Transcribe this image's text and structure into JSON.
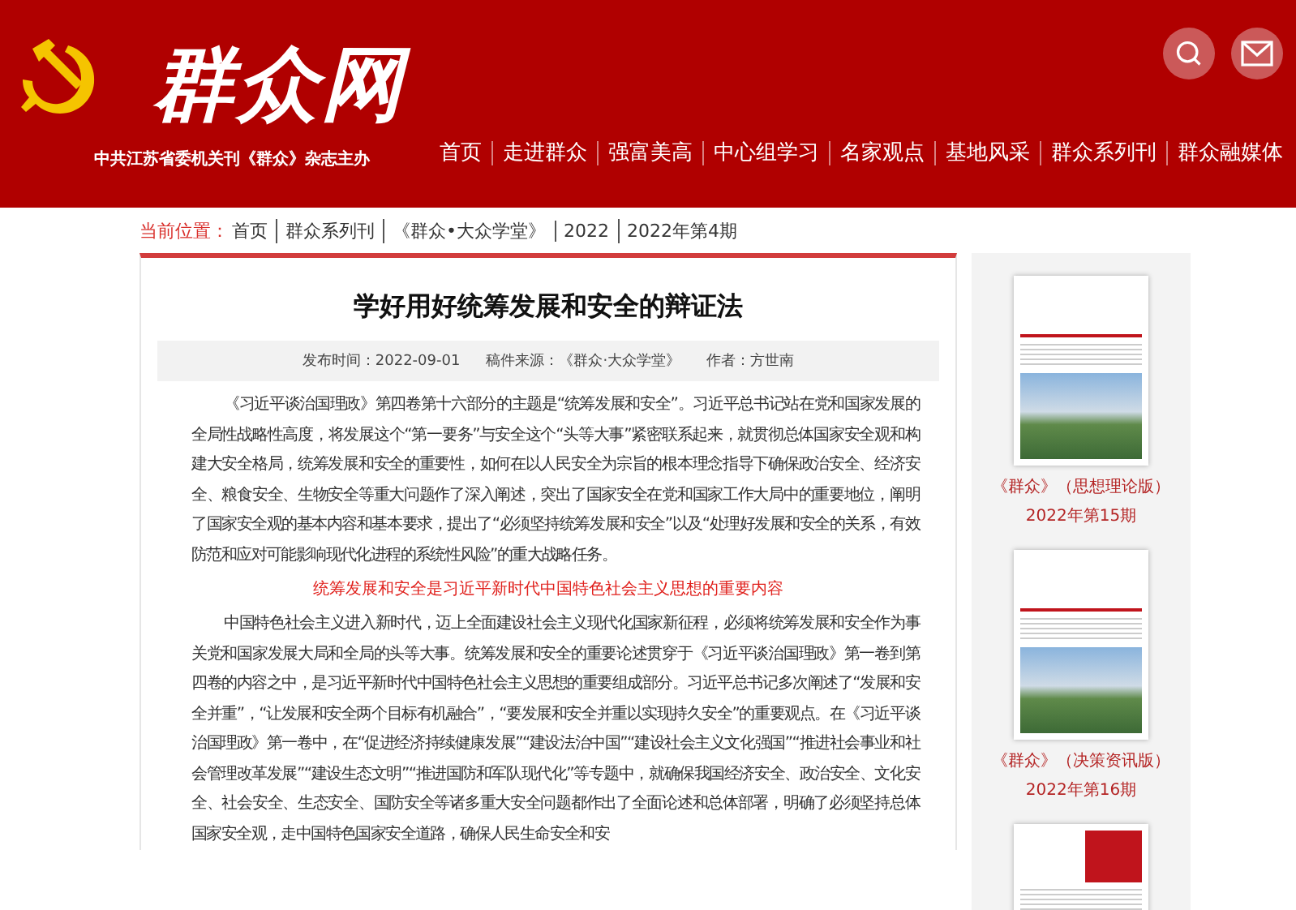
{
  "header": {
    "logo_text": "群众网",
    "subtitle": "中共江苏省委机关刊《群众》杂志主办"
  },
  "nav": [
    {
      "label": "首页"
    },
    {
      "label": "走进群众"
    },
    {
      "label": "强富美高"
    },
    {
      "label": "中心组学习"
    },
    {
      "label": "名家观点"
    },
    {
      "label": "基地风采"
    },
    {
      "label": "群众系列刊"
    },
    {
      "label": "群众融媒体"
    }
  ],
  "breadcrumb": {
    "label": "当前位置：",
    "items": [
      "首页",
      "群众系列刊",
      "《群众•大众学堂》",
      "2022",
      "2022年第4期"
    ]
  },
  "article": {
    "title": "学好用好统筹发展和安全的辩证法",
    "meta": [
      "发布时间：2022-09-01",
      "稿件来源：《群众·大众学堂》",
      "作者：方世南"
    ],
    "blocks": [
      {
        "kind": "paragraph",
        "text": "《习近平谈治国理政》第四卷第十六部分的主题是“统筹发展和安全”。习近平总书记站在党和国家发展的全局性战略性高度，将发展这个“第一要务”与安全这个“头等大事”紧密联系起来，就贯彻总体国家安全观和构建大安全格局，统筹发展和安全的重要性，如何在以人民安全为宗旨的根本理念指导下确保政治安全、经济安全、粮食安全、生物安全等重大问题作了深入阐述，突出了国家安全在党和国家工作大局中的重要地位，阐明了国家安全观的基本内容和基本要求，提出了“必须坚持统筹发展和安全”以及“处理好发展和安全的关系，有效防范和应对可能影响现代化进程的系统性风险”的重大战略任务。"
      },
      {
        "kind": "heading",
        "text": "统筹发展和安全是习近平新时代中国特色社会主义思想的重要内容"
      },
      {
        "kind": "paragraph",
        "text": "中国特色社会主义进入新时代，迈上全面建设社会主义现代化国家新征程，必须将统筹发展和安全作为事关党和国家发展大局和全局的头等大事。统筹发展和安全的重要论述贯穿于《习近平谈治国理政》第一卷到第四卷的内容之中，是习近平新时代中国特色社会主义思想的重要组成部分。习近平总书记多次阐述了“发展和安全并重”，“让发展和安全两个目标有机融合”，“要发展和安全并重以实现持久安全”的重要观点。在《习近平谈治国理政》第一卷中，在“促进经济持续健康发展”“建设法治中国”“建设社会主义文化强国”“推进社会事业和社会管理改革发展”“建设生态文明”“推进国防和军队现代化”等专题中，就确保我国经济安全、政治安全、文化安全、社会安全、生态安全、国防安全等诸多重大安全问题都作出了全面论述和总体部署，明确了必须坚持总体国家安全观，走中国特色国家安全道路，确保人民生命安全和安"
      }
    ]
  },
  "sidebar": [
    {
      "kind": "issue",
      "title": "《群众》（思想理论版）",
      "issue": "2022年第15期"
    },
    {
      "kind": "issue",
      "title": "《群众》（决策资讯版）",
      "issue": "2022年第16期"
    },
    {
      "kind": "cover"
    }
  ]
}
